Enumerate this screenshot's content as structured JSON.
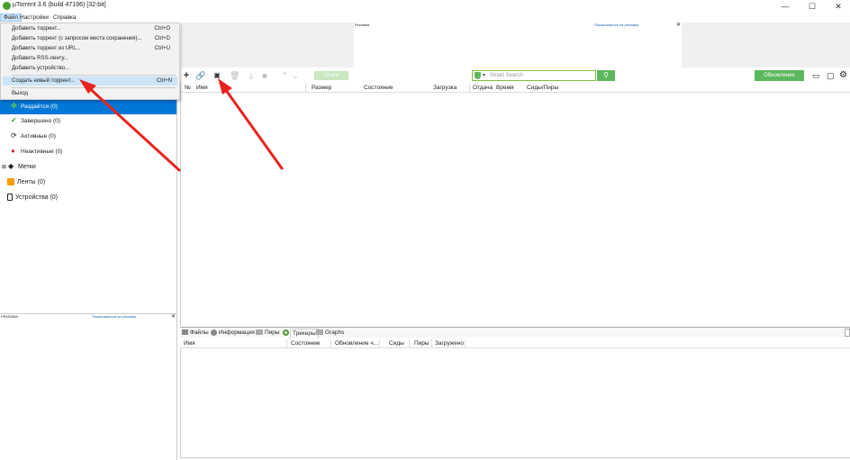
{
  "window": {
    "title": "µTorrent 3.6  (build 47196) [32-bit]",
    "min_glyph": "—",
    "max_glyph": "☐",
    "close_glyph": "✕"
  },
  "menubar": {
    "items": [
      {
        "label": "Файл"
      },
      {
        "label": "Настройки"
      },
      {
        "label": "Справка"
      }
    ]
  },
  "file_menu": {
    "items": [
      {
        "label": "Добавить торрент...",
        "shortcut": "Ctrl+O"
      },
      {
        "label": "Добавить торрент (с запросом места сохранения)...",
        "shortcut": "Ctrl+D"
      },
      {
        "label": "Добавить торрент из URL...",
        "shortcut": "Ctrl+U"
      },
      {
        "label": "Добавить RSS-ленту..."
      },
      {
        "label": "Добавить устройство..."
      },
      {
        "label": "Создать новый торрент...",
        "shortcut": "Ctrl+N"
      },
      {
        "label": "Выход"
      }
    ]
  },
  "ads": {
    "top_label": "Реклама",
    "top_link": "Пожаловаться на рекламу",
    "left_label": "РЕКЛАМА",
    "left_link": "Пожаловаться на рекламу",
    "close_glyph": "✕"
  },
  "sidebar": {
    "items": [
      {
        "label": "Раздаётся (0)",
        "icon": "seeding-icon"
      },
      {
        "label": "Завершено (0)",
        "icon": "check-icon"
      },
      {
        "label": "Активные (0)",
        "icon": "refresh-icon"
      },
      {
        "label": "Неактивные (0)",
        "icon": "inactive-icon"
      },
      {
        "label": "Метки",
        "icon": "tag-icon"
      },
      {
        "label": "Ленты (0)",
        "icon": "rss-icon"
      },
      {
        "label": "Устройства (0)",
        "icon": "device-icon"
      }
    ]
  },
  "toolbar": {
    "search_placeholder": "Smart Search",
    "update_label": "Обновление",
    "share_label": "Share"
  },
  "main_columns": [
    "№",
    "Имя",
    "Размер",
    "Состояние",
    "Загрузка",
    "Отдача",
    "Время",
    "Сиды/Пиры"
  ],
  "bottom_tabs": [
    "Файлы",
    "Информация",
    "Пиры",
    "Трекеры",
    "Graphs"
  ],
  "bottom_columns": [
    "Имя",
    "Состояние",
    "Обновление ч...",
    "Сиды",
    "Пиры",
    "Загружено"
  ],
  "colors": {
    "accent_green": "#5cb85c",
    "selection_blue": "#0078d7",
    "annotation_red": "#e8231f"
  }
}
